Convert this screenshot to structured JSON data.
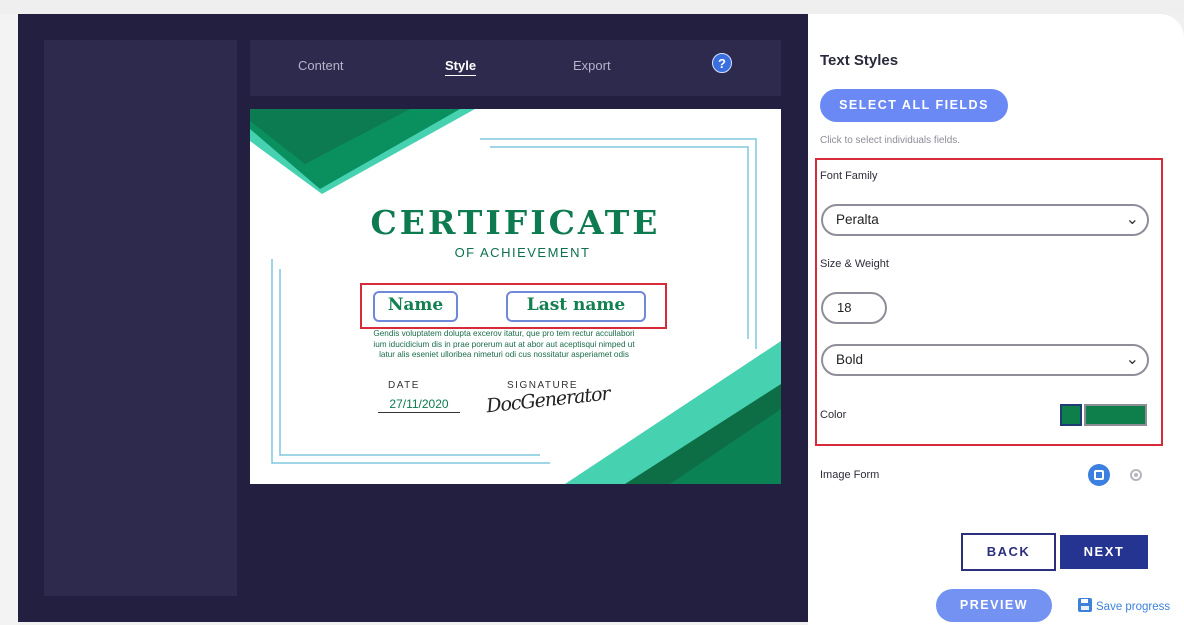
{
  "tabs": [
    {
      "label": "Content"
    },
    {
      "label": "Style"
    },
    {
      "label": "Export"
    }
  ],
  "help": {
    "label": "?"
  },
  "certificate": {
    "title": "CERTIFICATE",
    "subtitle": "OF ACHIEVEMENT",
    "first_name": "Name",
    "last_name": "Last name",
    "body_lines": [
      "Gendis voluptatem dolupta excerov itatur, que pro tem rectur accullabori",
      "ium iducidicium dis in prae porerum aut at abor aut aceptisqui nimped ut",
      "latur alis eseniet ulloribea nimeturi odi cus nossitatur asperiamet odis"
    ],
    "date_label": "DATE",
    "date_value": "27/11/2020",
    "signature_label": "SIGNATURE",
    "signature_script": "DocGenerator"
  },
  "panel": {
    "title": "Text Styles",
    "select_all": "SELECT ALL FIELDS",
    "hint": "Click to select individuals fields.",
    "font_family_label": "Font Family",
    "font_family_value": "Peralta",
    "size_weight_label": "Size & Weight",
    "size_value": "18",
    "weight_value": "Bold",
    "color_label": "Color",
    "color_value": "#0e7e4a",
    "image_form_label": "Image Form",
    "back": "BACK",
    "next": "NEXT",
    "preview": "PREVIEW",
    "save_progress": "Save progress"
  }
}
